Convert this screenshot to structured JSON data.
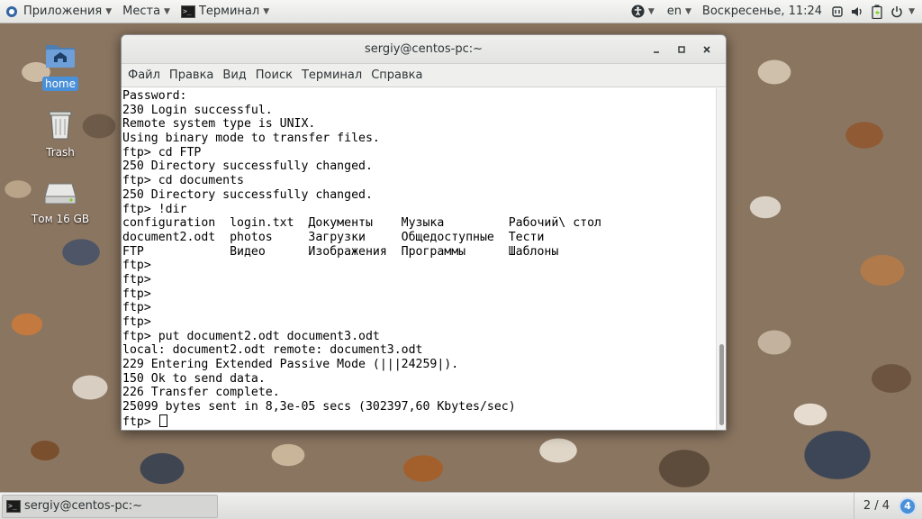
{
  "topbar": {
    "applications": "Приложения",
    "places": "Места",
    "terminal": "Терминал",
    "language": "en",
    "datetime": "Воскресенье, 11:24",
    "icons": [
      "accessibility-icon",
      "volume-icon",
      "battery-icon",
      "power-icon"
    ]
  },
  "desktop": {
    "icons": [
      {
        "label": "home",
        "icon": "folder-home-icon",
        "selected": true
      },
      {
        "label": "Trash",
        "icon": "trash-icon",
        "selected": false
      },
      {
        "label": "Том 16 GB",
        "icon": "drive-icon",
        "selected": false
      }
    ]
  },
  "window": {
    "title": "sergiy@centos-pc:~",
    "menu": [
      "Файл",
      "Правка",
      "Вид",
      "Поиск",
      "Терминал",
      "Справка"
    ],
    "terminal_lines": [
      "Password:",
      "230 Login successful.",
      "Remote system type is UNIX.",
      "Using binary mode to transfer files.",
      "ftp> cd FTP",
      "250 Directory successfully changed.",
      "ftp> cd documents",
      "250 Directory successfully changed.",
      "ftp> !dir",
      "configuration  login.txt  Документы    Музыка         Рабочий\\ стол",
      "document2.odt  photos     Загрузки     Общедоступные  Тести",
      "FTP            Видео      Изображения  Программы      Шаблоны",
      "ftp>",
      "ftp>",
      "ftp>",
      "ftp>",
      "ftp>",
      "ftp> put document2.odt document3.odt",
      "local: document2.odt remote: document3.odt",
      "229 Entering Extended Passive Mode (|||24259|).",
      "150 Ok to send data.",
      "226 Transfer complete.",
      "25099 bytes sent in 8,3e-05 secs (302397,60 Kbytes/sec)"
    ],
    "prompt": "ftp> "
  },
  "bottombar": {
    "task_label": "sergiy@centos-pc:~",
    "workspace": "2 / 4",
    "notifications": "4"
  }
}
